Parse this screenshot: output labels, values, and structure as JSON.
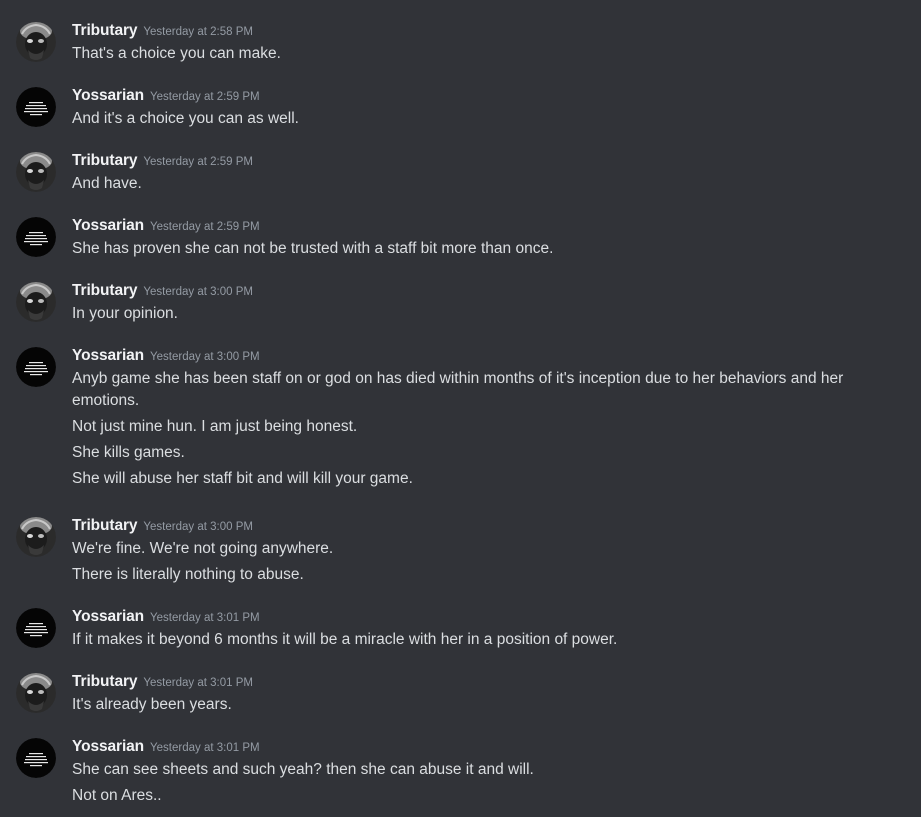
{
  "messages": [
    {
      "author": "Tributary",
      "avatar_icon": "tributary-avatar-icon",
      "timestamp": "Yesterday at 2:58 PM",
      "lines": [
        "That's a choice you can make."
      ]
    },
    {
      "author": "Yossarian",
      "avatar_icon": "yossarian-avatar-icon",
      "timestamp": "Yesterday at 2:59 PM",
      "lines": [
        "And it's a choice you can as well."
      ]
    },
    {
      "author": "Tributary",
      "avatar_icon": "tributary-avatar-icon",
      "timestamp": "Yesterday at 2:59 PM",
      "lines": [
        "And have."
      ]
    },
    {
      "author": "Yossarian",
      "avatar_icon": "yossarian-avatar-icon",
      "timestamp": "Yesterday at 2:59 PM",
      "lines": [
        "She has proven she can not be trusted with a staff bit more than once."
      ]
    },
    {
      "author": "Tributary",
      "avatar_icon": "tributary-avatar-icon",
      "timestamp": "Yesterday at 3:00 PM",
      "lines": [
        "In your opinion."
      ]
    },
    {
      "author": "Yossarian",
      "avatar_icon": "yossarian-avatar-icon",
      "timestamp": "Yesterday at 3:00 PM",
      "lines": [
        "Anyb game she has been staff on or god on has died within months of it's inception due to her behaviors and her emotions.",
        "Not just mine hun. I am just being honest.",
        "She kills games.",
        "She will abuse her staff bit and will kill your game."
      ]
    },
    {
      "author": "Tributary",
      "avatar_icon": "tributary-avatar-icon",
      "timestamp": "Yesterday at 3:00 PM",
      "lines": [
        "We're fine. We're not going anywhere.",
        "There is literally nothing to abuse."
      ]
    },
    {
      "author": "Yossarian",
      "avatar_icon": "yossarian-avatar-icon",
      "timestamp": "Yesterday at 3:01 PM",
      "lines": [
        "If it makes it beyond 6 months it will be a miracle with her in a position of power."
      ]
    },
    {
      "author": "Tributary",
      "avatar_icon": "tributary-avatar-icon",
      "timestamp": "Yesterday at 3:01 PM",
      "lines": [
        "It's already been years."
      ]
    },
    {
      "author": "Yossarian",
      "avatar_icon": "yossarian-avatar-icon",
      "timestamp": "Yesterday at 3:01 PM",
      "lines": [
        "She can see sheets and such yeah? then she can abuse it and will.",
        "Not on Ares.."
      ]
    }
  ]
}
